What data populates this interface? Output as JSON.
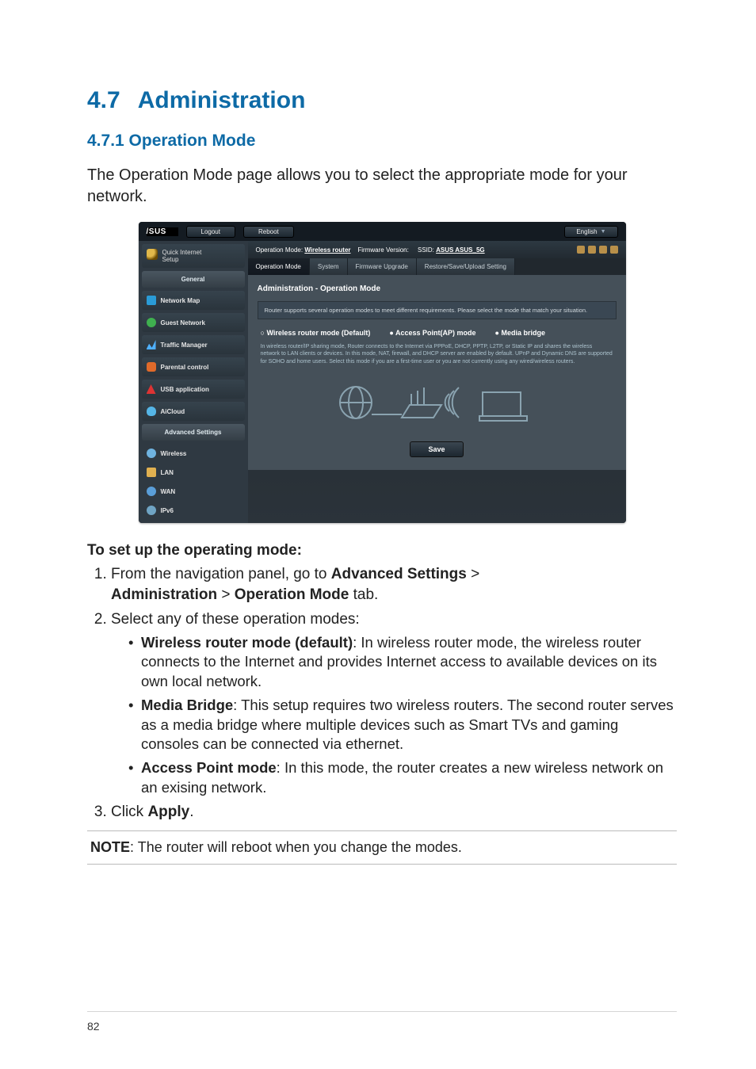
{
  "page_number": "82",
  "h1_num": "4.7",
  "h1_title": "Administration",
  "h2": "4.7.1 Operation Mode",
  "intro": "The Operation Mode page allows you to select the appropriate mode for your network.",
  "shot": {
    "logo": "/SUS",
    "logout": "Logout",
    "reboot": "Reboot",
    "lang": "English",
    "op_mode_label": "Operation Mode:",
    "op_mode_value": "Wireless router",
    "fw_label": "Firmware Version:",
    "ssid_label": "SSID:",
    "ssid_values": "ASUS  ASUS_5G",
    "tabs": {
      "t0": "Operation Mode",
      "t1": "System",
      "t2": "Firmware Upgrade",
      "t3": "Restore/Save/Upload Setting"
    },
    "side": {
      "qis_l1": "Quick Internet",
      "qis_l2": "Setup",
      "general": "General",
      "netmap": "Network Map",
      "guest": "Guest Network",
      "traffic": "Traffic Manager",
      "parental": "Parental control",
      "usb": "USB application",
      "cloud": "AiCloud",
      "adv": "Advanced Settings",
      "wireless": "Wireless",
      "lan": "LAN",
      "wan": "WAN",
      "ipv6": "IPv6"
    },
    "panel_title": "Administration - Operation Mode",
    "panel_hint": "Router supports several operation modes to meet different requirements. Please select the mode that match your situation.",
    "radio0": "Wireless router mode (Default)",
    "radio1": "Access Point(AP) mode",
    "radio2": "Media bridge",
    "desc1": "In wireless router/IP sharing mode, Router connects to the Internet via PPPoE, DHCP, PPTP, L2TP, or Static IP and shares the wireless network to LAN clients or devices. In this mode, NAT, firewall, and DHCP server are enabled by default. UPnP and Dynamic DNS are supported for SOHO and home users. Select this mode if you are a first-time user or you are not currently using any wired/wireless routers.",
    "save": "Save"
  },
  "setup_head": "To set up the operating mode:",
  "steps": {
    "s1a": "From the navigation panel, go to ",
    "s1_adv": "Advanced Settings",
    "s1_gt1": " > ",
    "s1_admin": "Administration",
    "s1_gt2": " > ",
    "s1_op": "Operation Mode",
    "s1_tab": " tab.",
    "s2": "Select any of these operation modes:",
    "m1_b": "Wireless router mode (default)",
    "m1_t": ": In wireless router mode, the wireless router connects to the Internet and provides Internet access to available devices on its own local network.",
    "m2_b": "Media Bridge",
    "m2_t": ": This setup requires two wireless routers. The second router serves as a media bridge where multiple devices such as Smart TVs and gaming consoles can be connected via ethernet.",
    "m3_b": "Access Point mode",
    "m3_t": ": In this mode, the router creates a new wireless network on an exising network.",
    "s3a": "Click ",
    "s3b": "Apply",
    "s3c": "."
  },
  "note_label": "NOTE",
  "note_text": ":  The router will reboot when you change the modes."
}
